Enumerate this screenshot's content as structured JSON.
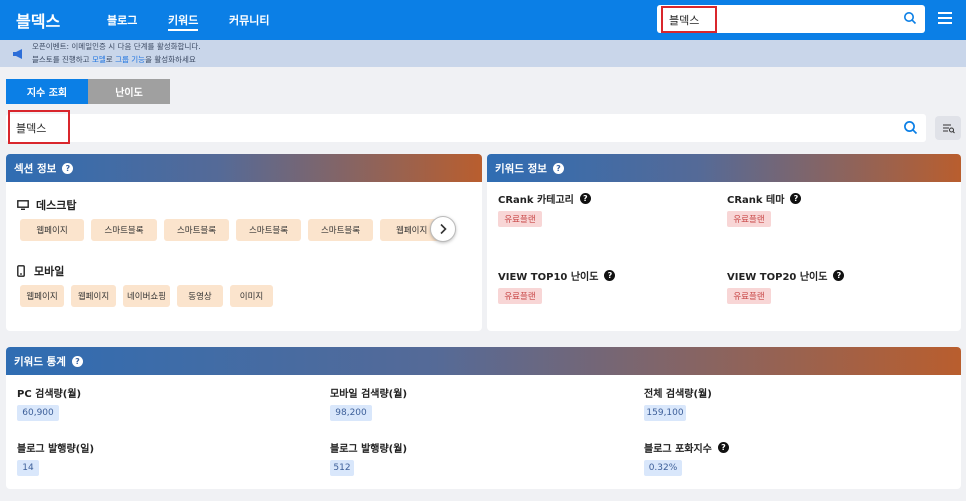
{
  "nav": {
    "logo": "블덱스",
    "links": [
      "블로그",
      "키워드",
      "커뮤니티"
    ],
    "search_value": "블덱스"
  },
  "notice": {
    "line1": "오픈이벤트: 이메일인증 시 다음 단계를 활성화합니다.",
    "line2_pre": "블스토를 진행하고 ",
    "line2_hl1": "모델",
    "line2_mid": "로 ",
    "line2_hl2": "그룹 기능",
    "line2_post": "을 활성화하세요"
  },
  "tabs": {
    "active": "지수 조회",
    "inactive": "난이도"
  },
  "search": {
    "value": "블덱스"
  },
  "section_info": {
    "title": "섹션 정보",
    "desktop_label": "데스크탑",
    "desktop_chips": [
      "웹페이지",
      "스마트블록",
      "스마트블록",
      "스마트블록",
      "스마트블록",
      "웹페이지"
    ],
    "mobile_label": "모바일",
    "mobile_chips": [
      "웹페이지",
      "웹페이지",
      "네이버쇼핑",
      "동영상",
      "이미지"
    ]
  },
  "keyword_info": {
    "title": "키워드 정보",
    "items": [
      {
        "label": "CRank 카테고리",
        "value": "유료플랜"
      },
      {
        "label": "CRank 테마",
        "value": "유료플랜"
      },
      {
        "label": "VIEW TOP10 난이도",
        "value": "유료플랜"
      },
      {
        "label": "VIEW TOP20 난이도",
        "value": "유료플랜"
      }
    ]
  },
  "keyword_stats": {
    "title": "키워드 통계",
    "items": [
      {
        "label": "PC 검색량(월)",
        "value": "60,900"
      },
      {
        "label": "모바일 검색량(월)",
        "value": "98,200"
      },
      {
        "label": "전체 검색량(월)",
        "value": "159,100"
      },
      {
        "label": "블로그 발행량(일)",
        "value": "14"
      },
      {
        "label": "블로그 발행량(월)",
        "value": "512"
      },
      {
        "label": "블로그 포화지수",
        "value": "0.32%"
      }
    ]
  },
  "colors": {
    "brand": "#0b7fe6",
    "highlight_box": "#d9262c",
    "chip": "#fbe4cd",
    "pill_red": "#f8d6d6",
    "pill_blue": "#d9e7fb"
  },
  "icons": [
    "search-icon",
    "menu-icon",
    "megaphone-icon",
    "help-icon",
    "desktop-icon",
    "mobile-icon",
    "chevron-right-icon",
    "filter-icon"
  ]
}
